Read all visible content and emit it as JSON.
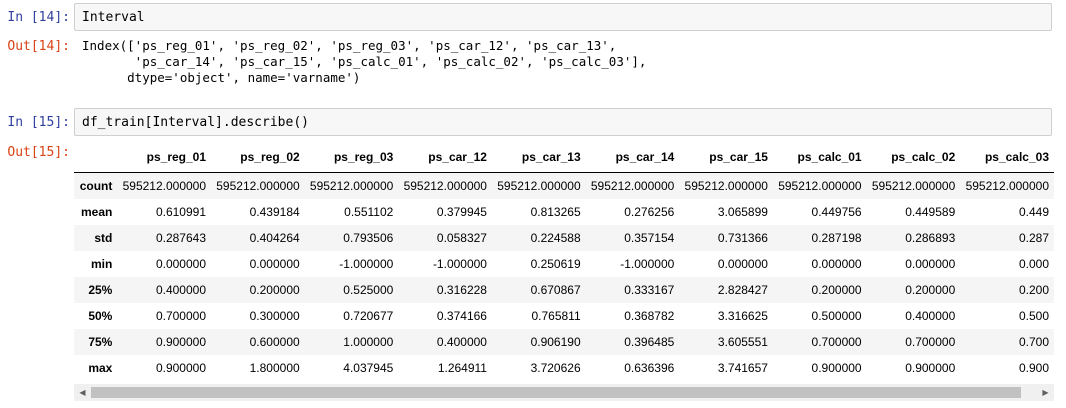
{
  "cells": [
    {
      "in_prompt": "In [14]:",
      "code": "Interval",
      "out_prompt": "Out[14]:",
      "output": "Index(['ps_reg_01', 'ps_reg_02', 'ps_reg_03', 'ps_car_12', 'ps_car_13',\n       'ps_car_14', 'ps_car_15', 'ps_calc_01', 'ps_calc_02', 'ps_calc_03'],\n      dtype='object', name='varname')"
    },
    {
      "in_prompt": "In [15]:",
      "code": "df_train[Interval].describe()",
      "out_prompt": "Out[15]:"
    }
  ],
  "table": {
    "columns": [
      "ps_reg_01",
      "ps_reg_02",
      "ps_reg_03",
      "ps_car_12",
      "ps_car_13",
      "ps_car_14",
      "ps_car_15",
      "ps_calc_01",
      "ps_calc_02",
      "ps_calc_03"
    ],
    "rows": [
      {
        "label": "count",
        "values": [
          "595212.000000",
          "595212.000000",
          "595212.000000",
          "595212.000000",
          "595212.000000",
          "595212.000000",
          "595212.000000",
          "595212.000000",
          "595212.000000",
          "595212.000000"
        ]
      },
      {
        "label": "mean",
        "values": [
          "0.610991",
          "0.439184",
          "0.551102",
          "0.379945",
          "0.813265",
          "0.276256",
          "3.065899",
          "0.449756",
          "0.449589",
          "0.449"
        ]
      },
      {
        "label": "std",
        "values": [
          "0.287643",
          "0.404264",
          "0.793506",
          "0.058327",
          "0.224588",
          "0.357154",
          "0.731366",
          "0.287198",
          "0.286893",
          "0.287"
        ]
      },
      {
        "label": "min",
        "values": [
          "0.000000",
          "0.000000",
          "-1.000000",
          "-1.000000",
          "0.250619",
          "-1.000000",
          "0.000000",
          "0.000000",
          "0.000000",
          "0.000"
        ]
      },
      {
        "label": "25%",
        "values": [
          "0.400000",
          "0.200000",
          "0.525000",
          "0.316228",
          "0.670867",
          "0.333167",
          "2.828427",
          "0.200000",
          "0.200000",
          "0.200"
        ]
      },
      {
        "label": "50%",
        "values": [
          "0.700000",
          "0.300000",
          "0.720677",
          "0.374166",
          "0.765811",
          "0.368782",
          "3.316625",
          "0.500000",
          "0.400000",
          "0.500"
        ]
      },
      {
        "label": "75%",
        "values": [
          "0.900000",
          "0.600000",
          "1.000000",
          "0.400000",
          "0.906190",
          "0.396485",
          "3.605551",
          "0.700000",
          "0.700000",
          "0.700"
        ]
      },
      {
        "label": "max",
        "values": [
          "0.900000",
          "1.800000",
          "4.037945",
          "1.264911",
          "3.720626",
          "0.636396",
          "3.741657",
          "0.900000",
          "0.900000",
          "0.900"
        ]
      }
    ]
  },
  "scrollbar": {
    "left_arrow": "◀",
    "right_arrow": "▶"
  },
  "colors": {
    "in_prompt": "#303f9f",
    "out_prompt": "#d84315",
    "input_bg": "#f7f7f7"
  }
}
